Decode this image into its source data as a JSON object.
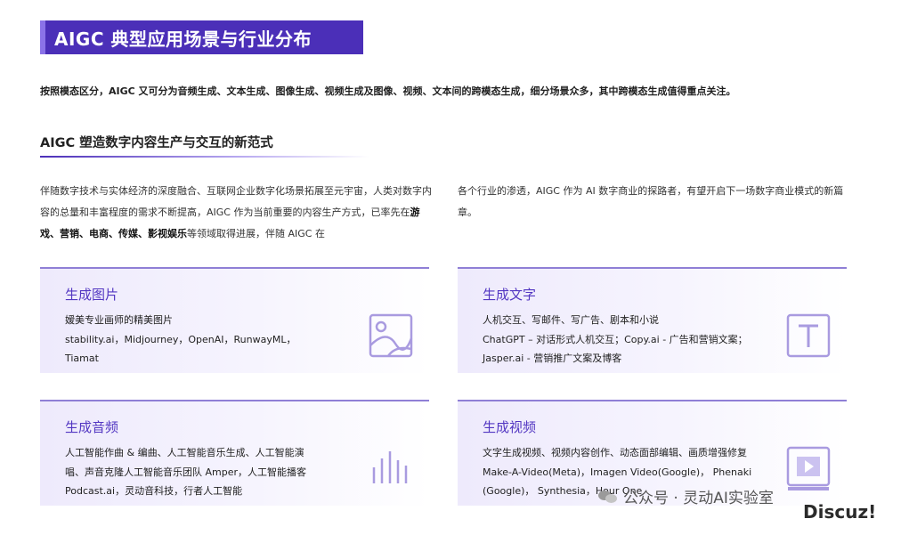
{
  "header": {
    "title": "AIGC 典型应用场景与行业分布",
    "intro": "按照模态区分，AIGC 又可分为音频生成、文本生成、图像生成、视频生成及图像、视频、文本间的跨模态生成，细分场景众多，其中跨模态生成值得重点关注。"
  },
  "section": {
    "subtitle": "AIGC 塑造数字内容生产与交互的新范式",
    "para_left_a": "伴随数字技术与实体经济的深度融合、互联网企业数字化场景拓展至元宇宙，人类对数字内容的总量和丰富程度的需求不断提高，AIGC 作为当前重要的内容生产方式，已率先在",
    "para_left_bold": "游戏、营销、电商、传媒、影视娱乐",
    "para_left_b": "等领域取得进展，伴随 AIGC 在",
    "para_right": "各个行业的渗透，AIGC 作为 AI 数字商业的探路者，有望开启下一场数字商业模式的新篇章。"
  },
  "cards": [
    {
      "title": "生成图片",
      "lines": [
        "嫒美专业画师的精美图片",
        "stability.ai，Midjourney，OpenAI，RunwayML，",
        "Tiamat"
      ],
      "icon": "image-icon"
    },
    {
      "title": "生成文字",
      "lines": [
        "人机交互、写邮件、写广告、剧本和小说",
        "ChatGPT – 对话形式人机交互；Copy.ai - 广告和营销文案；",
        "Jasper.ai - 营销推广文案及博客"
      ],
      "icon": "text-icon"
    },
    {
      "title": "生成音频",
      "lines": [
        "人工智能作曲 & 编曲、人工智能音乐生成、人工智能演",
        "唱、声音克隆人工智能音乐团队 Amper，人工智能播客",
        "Podcast.ai，灵动音科技，行者人工智能"
      ],
      "icon": "audio-icon"
    },
    {
      "title": "生成视频",
      "lines": [
        "文字生成视频、视频内容创作、动态面部编辑、画质增强修复",
        "Make-A-Video(Meta)，Imagen Video(Google)， Phenaki",
        "(Google)， Synthesia，Hour One"
      ],
      "icon": "video-icon"
    }
  ],
  "watermark": {
    "text": "公众号 · 灵动AI实验室",
    "logo": "Discuz!"
  },
  "colors": {
    "brand": "#4b2fb8",
    "card_title": "#5337c2",
    "icon": "#a99be0"
  }
}
